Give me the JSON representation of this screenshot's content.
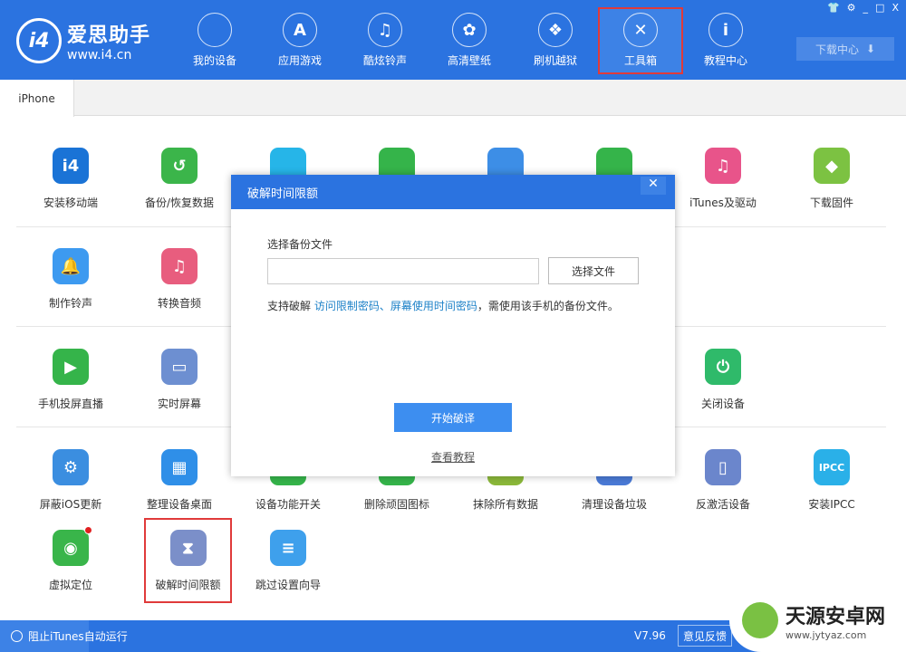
{
  "app": {
    "name": "爱思助手",
    "url": "www.i4.cn"
  },
  "nav": [
    {
      "label": "我的设备",
      "icon": "apple-icon",
      "glyph": ""
    },
    {
      "label": "应用游戏",
      "icon": "app-store-icon",
      "glyph": "A"
    },
    {
      "label": "酷炫铃声",
      "icon": "bell-icon",
      "glyph": "♫"
    },
    {
      "label": "高清壁纸",
      "icon": "flower-icon",
      "glyph": "✿"
    },
    {
      "label": "刷机越狱",
      "icon": "box-icon",
      "glyph": "❖"
    },
    {
      "label": "工具箱",
      "icon": "tools-icon",
      "glyph": "✕",
      "active": true
    },
    {
      "label": "教程中心",
      "icon": "info-icon",
      "glyph": "i"
    }
  ],
  "window_buttons": [
    "👕",
    "⚙",
    "_",
    "□",
    "X"
  ],
  "download_center": "下载中心",
  "device_tab": "iPhone",
  "tools": [
    [
      {
        "label": "安装移动端",
        "color": "#1a73d6",
        "glyph": "i4"
      },
      {
        "label": "备份/恢复数据",
        "color": "#3bb54a",
        "glyph": "↺"
      },
      {
        "label": "",
        "color": "#26b5e8",
        "glyph": ""
      },
      {
        "label": "",
        "color": "#35b44a",
        "glyph": ""
      },
      {
        "label": "",
        "color": "#3d8ee6",
        "glyph": ""
      },
      {
        "label": "",
        "color": "#35b44a",
        "glyph": ""
      },
      {
        "label": "iTunes及驱动",
        "color": "#e8548a",
        "glyph": "♫"
      },
      {
        "label": "下载固件",
        "color": "#7cc242",
        "glyph": "◆"
      }
    ],
    [
      {
        "label": "制作铃声",
        "color": "#3d9af0",
        "glyph": "🔔"
      },
      {
        "label": "转换音频",
        "color": "#e85d7e",
        "glyph": "♫"
      }
    ],
    [
      {
        "label": "手机投屏直播",
        "color": "#35b44a",
        "glyph": "▶"
      },
      {
        "label": "实时屏幕",
        "color": "#6d8fd1",
        "glyph": "▭"
      },
      null,
      null,
      null,
      null,
      {
        "label": "关闭设备",
        "color": "#2fba6a",
        "glyph": "⏻"
      }
    ],
    [
      {
        "label": "屏蔽iOS更新",
        "color": "#3b8ee0",
        "glyph": "⚙"
      },
      {
        "label": "整理设备桌面",
        "color": "#2f8fe8",
        "glyph": "▦"
      },
      {
        "label": "设备功能开关",
        "color": "#35b44a",
        "glyph": ""
      },
      {
        "label": "删除顽固图标",
        "color": "#35b44a",
        "glyph": ""
      },
      {
        "label": "抹除所有数据",
        "color": "#8bb83a",
        "glyph": ""
      },
      {
        "label": "清理设备垃圾",
        "color": "#4a7ad6",
        "glyph": ""
      },
      {
        "label": "反激活设备",
        "color": "#6b86cc",
        "glyph": "▯"
      },
      {
        "label": "安装IPCC",
        "color": "#2ab0e8",
        "glyph": "IPCC"
      }
    ],
    [
      {
        "label": "虚拟定位",
        "color": "#39b54a",
        "glyph": "◉",
        "badge": true
      },
      {
        "label": "破解时间限额",
        "color": "#7b8fc9",
        "glyph": "⧗",
        "highlight": true
      },
      {
        "label": "跳过设置向导",
        "color": "#3ea0ec",
        "glyph": "≡"
      }
    ]
  ],
  "dialog": {
    "title": "破解时间限额",
    "close": "✕",
    "file_label": "选择备份文件",
    "file_value": "",
    "pick_button": "选择文件",
    "note_prefix": "支持破解 ",
    "note_link1": "访问限制密码",
    "note_sep": "、",
    "note_link2": "屏幕使用时间密码",
    "note_suffix": "，需使用该手机的备份文件。",
    "start_button": "开始破译",
    "tutorial_link": "查看教程"
  },
  "status": {
    "block_itunes": "阻止iTunes自动运行",
    "version": "V7.96",
    "feedback": "意见反馈"
  },
  "watermark": {
    "name": "天源安卓网",
    "url": "www.jytyaz.com"
  }
}
